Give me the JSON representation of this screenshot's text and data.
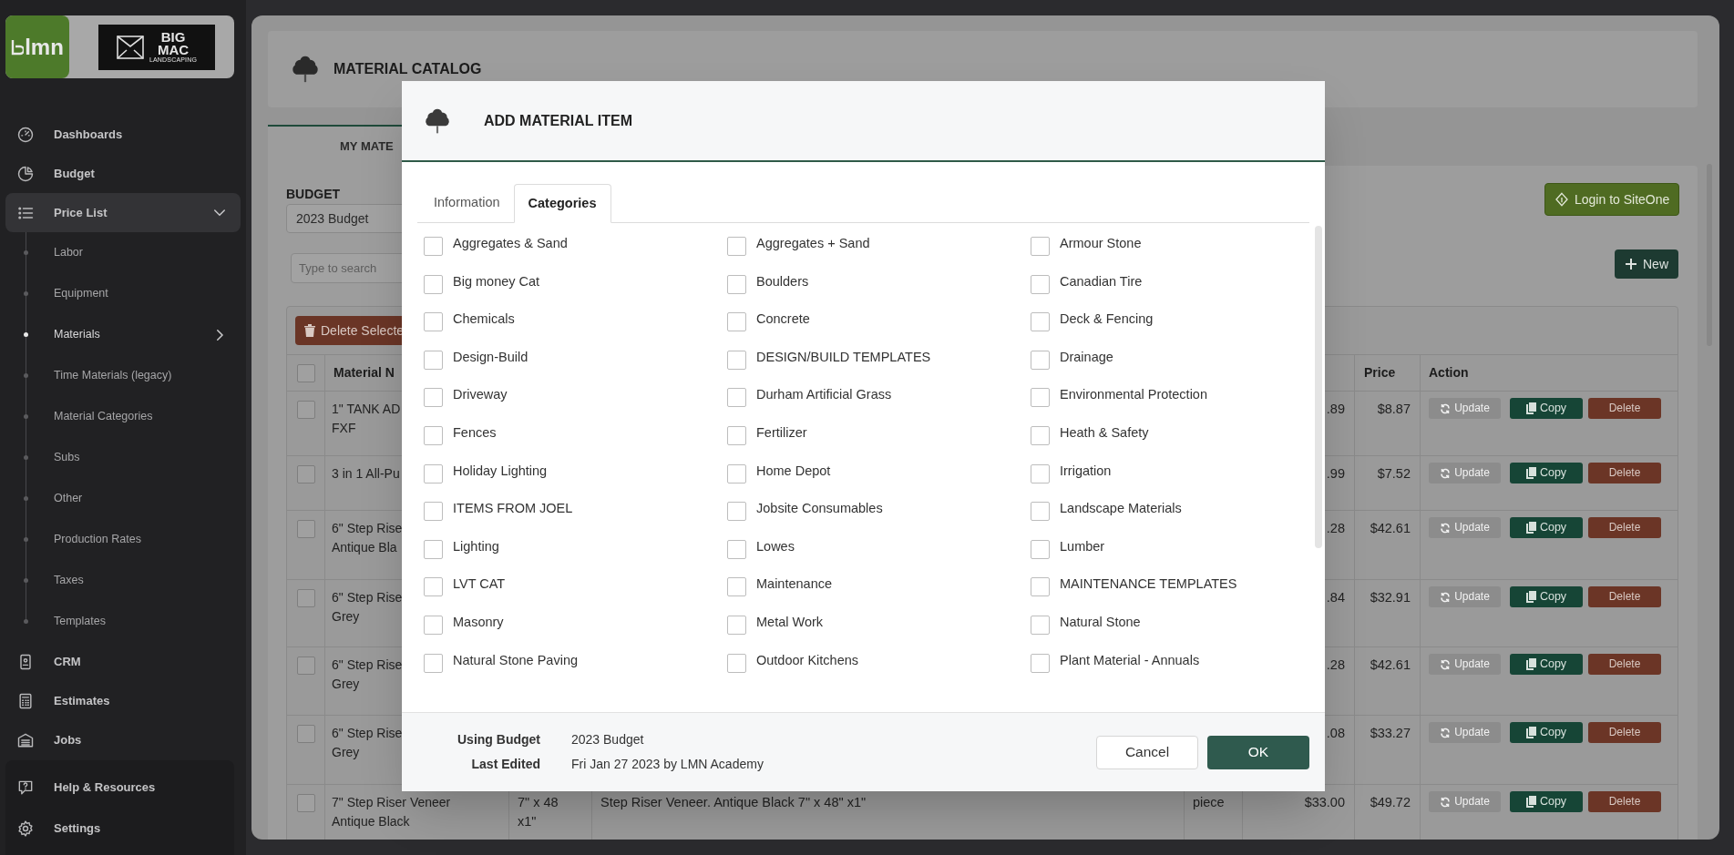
{
  "sidebar": {
    "logo": {
      "brand": "lmn",
      "company_lines": [
        "BIG",
        "MAC",
        "LANDSCAPING"
      ]
    },
    "items": [
      {
        "label": "Dashboards"
      },
      {
        "label": "Budget"
      },
      {
        "label": "Price List",
        "expanded": true,
        "children": [
          {
            "label": "Labor",
            "selected": false
          },
          {
            "label": "Equipment",
            "selected": false
          },
          {
            "label": "Materials",
            "selected": true
          },
          {
            "label": "Time Materials (legacy)",
            "selected": false
          },
          {
            "label": "Material Categories",
            "selected": false
          },
          {
            "label": "Subs",
            "selected": false
          },
          {
            "label": "Other",
            "selected": false
          },
          {
            "label": "Production Rates",
            "selected": false
          },
          {
            "label": "Taxes",
            "selected": false
          },
          {
            "label": "Templates",
            "selected": false
          }
        ]
      },
      {
        "label": "CRM"
      },
      {
        "label": "Estimates"
      },
      {
        "label": "Jobs"
      }
    ],
    "footer_items": [
      {
        "label": "Help & Resources"
      },
      {
        "label": "Settings"
      }
    ]
  },
  "main": {
    "title": "MATERIAL CATALOG",
    "tabs": [
      {
        "label": "MY MATE",
        "selected": true
      }
    ],
    "budget": {
      "label": "BUDGET",
      "value": "2023 Budget"
    },
    "search": {
      "placeholder": "Type to search"
    },
    "login_button": "Login to SiteOne",
    "new_button": "New",
    "delete_selected_button": "Delete Selecte",
    "table": {
      "header": {
        "checked": false,
        "name": "Material N",
        "price": "Price",
        "action": "Action"
      },
      "rows": [
        {
          "checked": false,
          "name_lines": [
            "1\" TANK AD",
            "FXF"
          ],
          "cost": ".89",
          "price": "$8.87",
          "update": {
            "label": "Update",
            "disabled": true
          },
          "copy": "Copy",
          "delete": "Delete"
        },
        {
          "checked": false,
          "name_lines": [
            "3 in 1 All-Pu"
          ],
          "cost": ".99",
          "price": "$7.52",
          "update": {
            "label": "Update",
            "disabled": true
          },
          "copy": "Copy",
          "delete": "Delete"
        },
        {
          "checked": false,
          "name_lines": [
            "6\" Step Rise",
            "Antique Bla"
          ],
          "cost": ".28",
          "price": "$42.61",
          "update": {
            "label": "Update",
            "disabled": true
          },
          "copy": "Copy",
          "delete": "Delete"
        },
        {
          "checked": false,
          "name_lines": [
            "6\" Step Rise",
            "Grey"
          ],
          "cost": ".84",
          "price": "$32.91",
          "update": {
            "label": "Update",
            "disabled": true
          },
          "copy": "Copy",
          "delete": "Delete"
        },
        {
          "checked": false,
          "name_lines": [
            "6\" Step Rise",
            "Grey"
          ],
          "cost": ".28",
          "price": "$42.61",
          "update": {
            "label": "Update",
            "disabled": true
          },
          "copy": "Copy",
          "delete": "Delete"
        },
        {
          "checked": false,
          "name_lines": [
            "6\" Step Rise",
            "Grey"
          ],
          "cost": ".08",
          "price": "$33.27",
          "update": {
            "label": "Update",
            "disabled": true
          },
          "copy": "Copy",
          "delete": "Delete"
        },
        {
          "checked": false,
          "name_lines": [
            "7\" Step Riser Veneer",
            "Antique Black"
          ],
          "size_lines": [
            "7\" x 48",
            "x1\""
          ],
          "description": "Step Riser Veneer. Antique Black 7\" x 48\" x1\"",
          "unit": "piece",
          "cost": "$33.00",
          "price": "$49.72",
          "update": {
            "label": "Update",
            "disabled": true
          },
          "copy": "Copy",
          "delete": "Delete"
        }
      ]
    }
  },
  "modal": {
    "title": "ADD MATERIAL ITEM",
    "tabs": [
      {
        "label": "Information",
        "selected": false
      },
      {
        "label": "Categories",
        "selected": true
      }
    ],
    "categories": [
      {
        "label": "Aggregates & Sand",
        "checked": false
      },
      {
        "label": "Aggregates + Sand",
        "checked": false
      },
      {
        "label": "Armour Stone",
        "checked": false
      },
      {
        "label": "Big money Cat",
        "checked": false
      },
      {
        "label": "Boulders",
        "checked": false
      },
      {
        "label": "Canadian Tire",
        "checked": false
      },
      {
        "label": "Chemicals",
        "checked": false
      },
      {
        "label": "Concrete",
        "checked": false
      },
      {
        "label": "Deck & Fencing",
        "checked": false
      },
      {
        "label": "Design-Build",
        "checked": false
      },
      {
        "label": "DESIGN/BUILD TEMPLATES",
        "checked": false
      },
      {
        "label": "Drainage",
        "checked": false
      },
      {
        "label": "Driveway",
        "checked": false
      },
      {
        "label": "Durham Artificial Grass",
        "checked": false
      },
      {
        "label": "Environmental Protection",
        "checked": false
      },
      {
        "label": "Fences",
        "checked": false
      },
      {
        "label": "Fertilizer",
        "checked": false
      },
      {
        "label": "Heath & Safety",
        "checked": false
      },
      {
        "label": "Holiday Lighting",
        "checked": false
      },
      {
        "label": "Home Depot",
        "checked": false
      },
      {
        "label": "Irrigation",
        "checked": false
      },
      {
        "label": "ITEMS FROM JOEL",
        "checked": false
      },
      {
        "label": "Jobsite Consumables",
        "checked": false
      },
      {
        "label": "Landscape Materials",
        "checked": false
      },
      {
        "label": "Lighting",
        "checked": false
      },
      {
        "label": "Lowes",
        "checked": false
      },
      {
        "label": "Lumber",
        "checked": false
      },
      {
        "label": "LVT CAT",
        "checked": false
      },
      {
        "label": "Maintenance",
        "checked": false
      },
      {
        "label": "MAINTENANCE TEMPLATES",
        "checked": false
      },
      {
        "label": "Masonry",
        "checked": false
      },
      {
        "label": "Metal Work",
        "checked": false
      },
      {
        "label": "Natural Stone",
        "checked": false
      },
      {
        "label": "Natural Stone Paving",
        "checked": false
      },
      {
        "label": "Outdoor Kitchens",
        "checked": false
      },
      {
        "label": "Plant Material - Annuals",
        "checked": false
      }
    ],
    "footer": {
      "using_budget_label": "Using Budget",
      "using_budget": "2023 Budget",
      "last_edited_label": "Last Edited",
      "last_edited": "Fri Jan 27 2023 by LMN Academy"
    },
    "cancel_button": "Cancel",
    "ok_button": "OK"
  }
}
